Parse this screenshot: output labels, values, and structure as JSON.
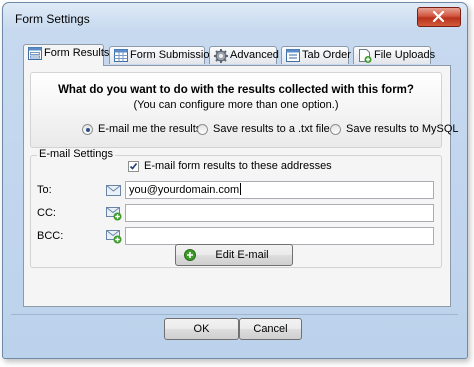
{
  "window": {
    "title": "Form Settings"
  },
  "tabs": [
    {
      "label": "Form Results",
      "icon": "form-icon",
      "active": true
    },
    {
      "label": "Form Submission",
      "icon": "table-icon",
      "active": false
    },
    {
      "label": "Advanced",
      "icon": "gear-icon",
      "active": false
    },
    {
      "label": "Tab Order",
      "icon": "tab-order-icon",
      "active": false
    },
    {
      "label": "File Uploads",
      "icon": "file-upload-icon",
      "active": false
    }
  ],
  "results": {
    "question": "What do you want to do with the results collected with this form?",
    "subtitle": "(You can configure more than one option.)",
    "options": [
      {
        "label": "E-mail me the results",
        "selected": true
      },
      {
        "label": "Save results to a .txt file",
        "selected": false
      },
      {
        "label": "Save results to MySQL",
        "selected": false
      }
    ]
  },
  "email": {
    "group_label": "E-mail Settings",
    "checkbox_label": "E-mail form results to these addresses",
    "checkbox_checked": true,
    "to_label": "To:",
    "to_value": "you@yourdomain.com",
    "cc_label": "CC:",
    "cc_value": "",
    "bcc_label": "BCC:",
    "bcc_value": "",
    "edit_button": "Edit E-mail"
  },
  "footer": {
    "ok": "OK",
    "cancel": "Cancel"
  },
  "colors": {
    "title_gradient_top": "#dfeaf6",
    "title_gradient_bottom": "#bcd2ec",
    "close_button": "#c8452d",
    "panel": "#f5f5f5",
    "add_icon": "#3e9b2a"
  }
}
